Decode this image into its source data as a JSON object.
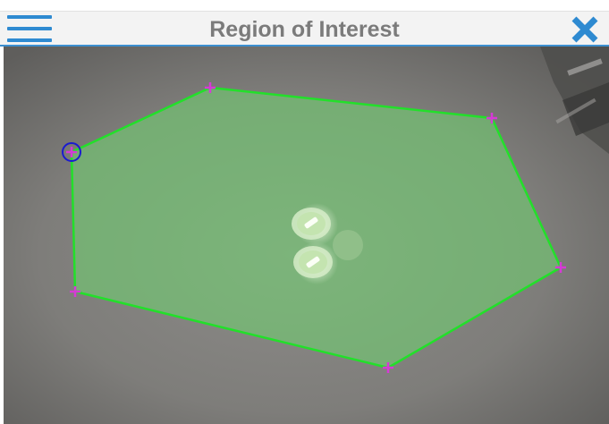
{
  "header": {
    "title": "Region of Interest",
    "menu_icon": "hamburger-menu-icon",
    "close_icon": "close-x-icon"
  },
  "colors": {
    "accent": "#2e8ad1",
    "title_text": "#7b7b7b",
    "region_fill": "#6fd66f",
    "region_outline": "#22e02a",
    "vertex_marker": "#d63ad6",
    "selected_vertex_ring": "#1a1ad0"
  },
  "region": {
    "selected_vertex": 6
  }
}
